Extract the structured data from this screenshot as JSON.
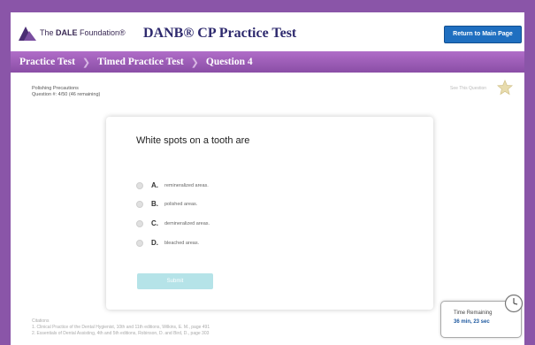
{
  "header": {
    "logo_text_prefix": "The ",
    "logo_text_bold": "DALE",
    "logo_text_suffix": " Foundation®",
    "app_title": "DANB® CP Practice Test",
    "return_button": "Return to Main Page"
  },
  "breadcrumb": [
    "Practice Test",
    "Timed Practice Test",
    "Question 4"
  ],
  "question_meta": {
    "topic": "Polishing Precautions",
    "number": "Question #: 4/50 (46 remaining)"
  },
  "see_question": "See This Question",
  "question": {
    "text": "White spots on a tooth are",
    "answers": [
      {
        "letter": "A.",
        "text": "remineralized areas."
      },
      {
        "letter": "B.",
        "text": "polished areas."
      },
      {
        "letter": "C.",
        "text": "demineralized areas."
      },
      {
        "letter": "D.",
        "text": "bleached areas."
      }
    ],
    "submit_label": "Submit"
  },
  "citations": {
    "title": "Citations",
    "lines": [
      "1. Clinical Practice of the Dental Hygienist, 10th and 11th editions, Wilkins, E. M., page 491",
      "2. Essentials of Dental Assisting, 4th and 5th editions, Robinson, D. and Bird, D., page 303"
    ]
  },
  "timer": {
    "label": "Time Remaining",
    "value": "36 min, 23 sec"
  },
  "colors": {
    "frame": "#8a55a8",
    "breadcrumb": "#9b5cb8",
    "button": "#1f6fc0",
    "submit": "#b5e3e8",
    "title": "#2e2a6e"
  }
}
